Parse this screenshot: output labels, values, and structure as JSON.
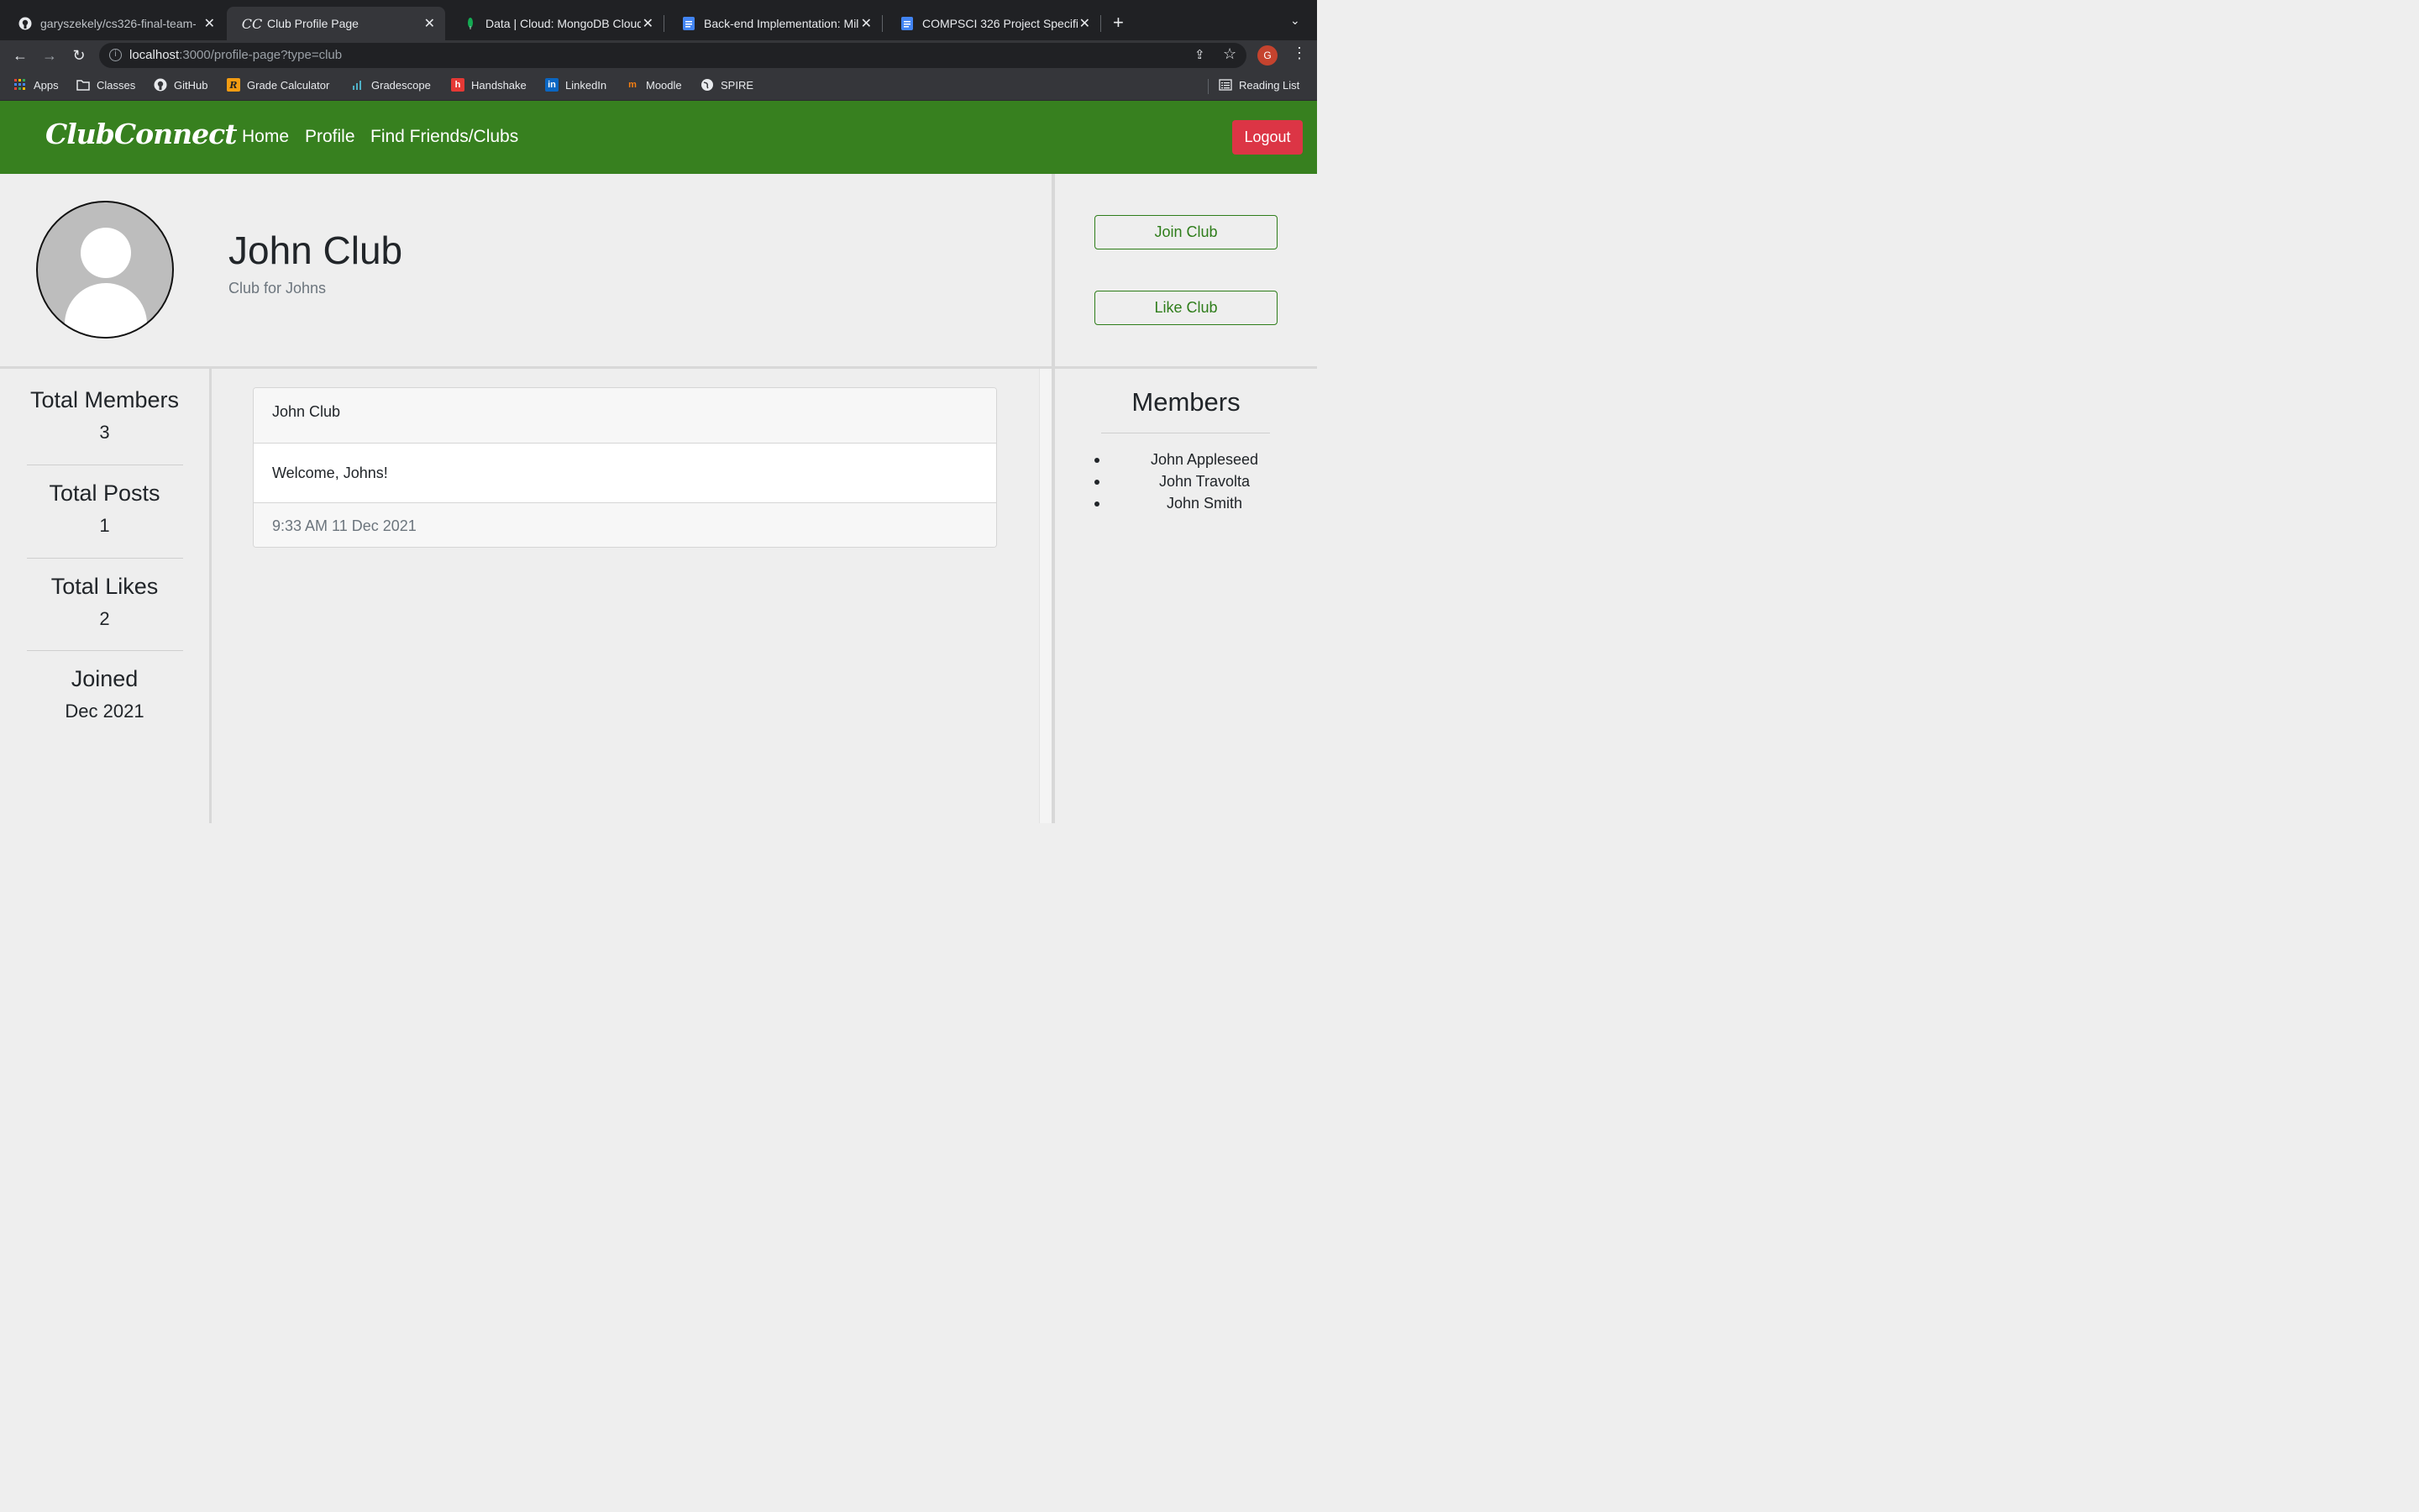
{
  "browser": {
    "tabs": [
      {
        "label": "garyszekely/cs326-final-team-",
        "icon": "github-icon"
      },
      {
        "label": "Club Profile Page",
        "icon": "clubconnect-icon"
      },
      {
        "label": "Data | Cloud: MongoDB Cloud",
        "icon": "mongodb-leaf-icon"
      },
      {
        "label": "Back-end Implementation: Mile",
        "icon": "google-docs-icon"
      },
      {
        "label": "COMPSCI 326 Project Specific",
        "icon": "google-docs-icon"
      }
    ],
    "url_host": "localhost",
    "url_rest": ":3000/profile-page?type=club",
    "profile_initial": "G",
    "bookmarks": [
      {
        "label": "Apps",
        "icon": "apps-grid-icon"
      },
      {
        "label": "Classes",
        "icon": "folder-icon"
      },
      {
        "label": "GitHub",
        "icon": "github-icon"
      },
      {
        "label": "Grade Calculator",
        "icon": "grade-calculator-icon"
      },
      {
        "label": "Gradescope",
        "icon": "gradescope-icon"
      },
      {
        "label": "Handshake",
        "icon": "handshake-icon"
      },
      {
        "label": "LinkedIn",
        "icon": "linkedin-icon"
      },
      {
        "label": "Moodle",
        "icon": "moodle-icon"
      },
      {
        "label": "SPIRE",
        "icon": "globe-icon"
      }
    ],
    "reading_list": "Reading List"
  },
  "nav": {
    "brand": "ClubConnect",
    "links": [
      "Home",
      "Profile",
      "Find Friends/Clubs"
    ],
    "logout": "Logout",
    "brand_color": "#37801f"
  },
  "profile": {
    "name": "John Club",
    "description": "Club for Johns",
    "join_button": "Join Club",
    "like_button": "Like Club"
  },
  "stats": [
    {
      "label": "Total Members",
      "value": "3"
    },
    {
      "label": "Total Posts",
      "value": "1"
    },
    {
      "label": "Total Likes",
      "value": "2"
    },
    {
      "label": "Joined",
      "value": "Dec 2021"
    }
  ],
  "post": {
    "title": "John Club",
    "body": "Welcome, Johns!",
    "timestamp": "9:33 AM 11 Dec 2021"
  },
  "members": {
    "title": "Members",
    "list": [
      "John Appleseed",
      "John Travolta",
      "John Smith"
    ]
  }
}
